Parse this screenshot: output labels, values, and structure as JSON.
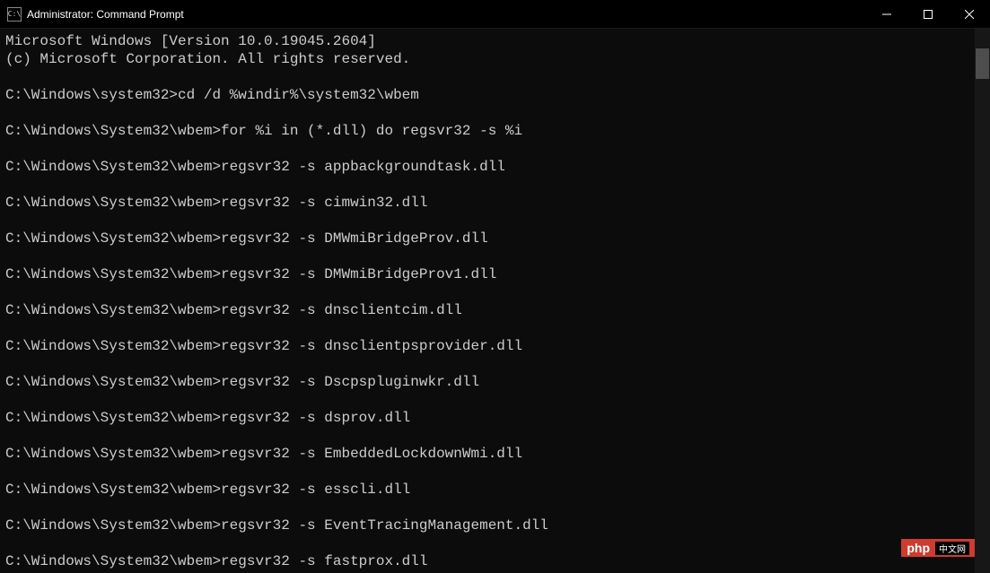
{
  "window": {
    "title": "Administrator: Command Prompt",
    "icon_label": "C:\\"
  },
  "terminal": {
    "header1": "Microsoft Windows [Version 10.0.19045.2604]",
    "header2": "(c) Microsoft Corporation. All rights reserved.",
    "prompt_initial": "C:\\Windows\\system32>",
    "prompt_wbem": "C:\\Windows\\System32\\wbem>",
    "cmd_cd": "cd /d %windir%\\system32\\wbem",
    "cmd_for": "for %i in (*.dll) do regsvr32 -s %i",
    "regsvr_prefix": "regsvr32 -s ",
    "dlls": [
      "appbackgroundtask.dll",
      "cimwin32.dll",
      "DMWmiBridgeProv.dll",
      "DMWmiBridgeProv1.dll",
      "dnsclientcim.dll",
      "dnsclientpsprovider.dll",
      "Dscpspluginwkr.dll",
      "dsprov.dll",
      "EmbeddedLockdownWmi.dll",
      "esscli.dll",
      "EventTracingManagement.dll",
      "fastprox.dll"
    ]
  },
  "watermark": {
    "text": "php",
    "suffix": "中文网"
  }
}
